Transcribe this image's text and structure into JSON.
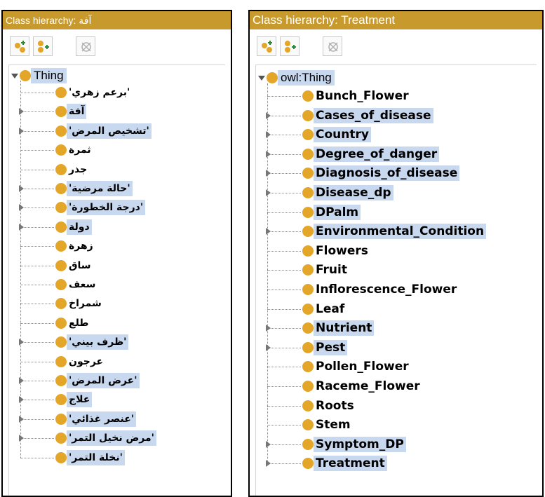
{
  "left_panel": {
    "title": "Class hierarchy: آفة",
    "root_label": "Thing",
    "items": [
      {
        "label": "'برعم زهري'",
        "selected": false,
        "expandable": false
      },
      {
        "label": "آفة",
        "selected": true,
        "expandable": true
      },
      {
        "label": "'تشخيص المرض'",
        "selected": true,
        "expandable": true
      },
      {
        "label": "ثمرة",
        "selected": false,
        "expandable": false
      },
      {
        "label": "جذر",
        "selected": false,
        "expandable": false
      },
      {
        "label": "'حالة مرضية'",
        "selected": true,
        "expandable": true
      },
      {
        "label": "'درجة الخطورة'",
        "selected": true,
        "expandable": true
      },
      {
        "label": "دولة",
        "selected": true,
        "expandable": true
      },
      {
        "label": "زهرة",
        "selected": false,
        "expandable": false
      },
      {
        "label": "ساق",
        "selected": false,
        "expandable": false
      },
      {
        "label": "سعف",
        "selected": false,
        "expandable": false
      },
      {
        "label": "شمراخ",
        "selected": false,
        "expandable": false
      },
      {
        "label": "طلع",
        "selected": false,
        "expandable": false
      },
      {
        "label": "'ظرف بيني'",
        "selected": true,
        "expandable": true
      },
      {
        "label": "عرجون",
        "selected": false,
        "expandable": false
      },
      {
        "label": "'عرض المرض'",
        "selected": true,
        "expandable": true
      },
      {
        "label": "علاج",
        "selected": true,
        "expandable": true
      },
      {
        "label": "'عنصر غذائي'",
        "selected": true,
        "expandable": true
      },
      {
        "label": "'مرض نخيل التمر'",
        "selected": true,
        "expandable": true
      },
      {
        "label": "'نخلة التمر'",
        "selected": true,
        "expandable": false
      }
    ]
  },
  "right_panel": {
    "title": "Class hierarchy: Treatment",
    "root_label": "owl:Thing",
    "items": [
      {
        "label": "Bunch_Flower",
        "selected": false,
        "expandable": false
      },
      {
        "label": "Cases_of_disease",
        "selected": true,
        "expandable": true
      },
      {
        "label": "Country",
        "selected": true,
        "expandable": true
      },
      {
        "label": "Degree_of_danger",
        "selected": true,
        "expandable": true
      },
      {
        "label": "Diagnosis_of_disease",
        "selected": true,
        "expandable": true
      },
      {
        "label": "Disease_dp",
        "selected": true,
        "expandable": true
      },
      {
        "label": "DPalm",
        "selected": true,
        "expandable": false
      },
      {
        "label": "Environmental_Condition",
        "selected": true,
        "expandable": true
      },
      {
        "label": "Flowers",
        "selected": false,
        "expandable": false
      },
      {
        "label": "Fruit",
        "selected": false,
        "expandable": false
      },
      {
        "label": "Inflorescence_Flower",
        "selected": false,
        "expandable": false
      },
      {
        "label": "Leaf",
        "selected": false,
        "expandable": false
      },
      {
        "label": "Nutrient",
        "selected": true,
        "expandable": true
      },
      {
        "label": "Pest",
        "selected": true,
        "expandable": true
      },
      {
        "label": "Pollen_Flower",
        "selected": false,
        "expandable": false
      },
      {
        "label": "Raceme_Flower",
        "selected": false,
        "expandable": false
      },
      {
        "label": "Roots",
        "selected": false,
        "expandable": false
      },
      {
        "label": "Stem",
        "selected": false,
        "expandable": false
      },
      {
        "label": "Symptom_DP",
        "selected": true,
        "expandable": true
      },
      {
        "label": "Treatment",
        "selected": true,
        "expandable": true
      }
    ]
  },
  "toolbar": {
    "buttons": [
      "add-subclass-icon",
      "add-sibling-class-icon",
      "delete-class-icon"
    ]
  },
  "colors": {
    "title_bar": "#c89a2d",
    "class_dot": "#e3a628",
    "selection": "#c8d8ee"
  }
}
